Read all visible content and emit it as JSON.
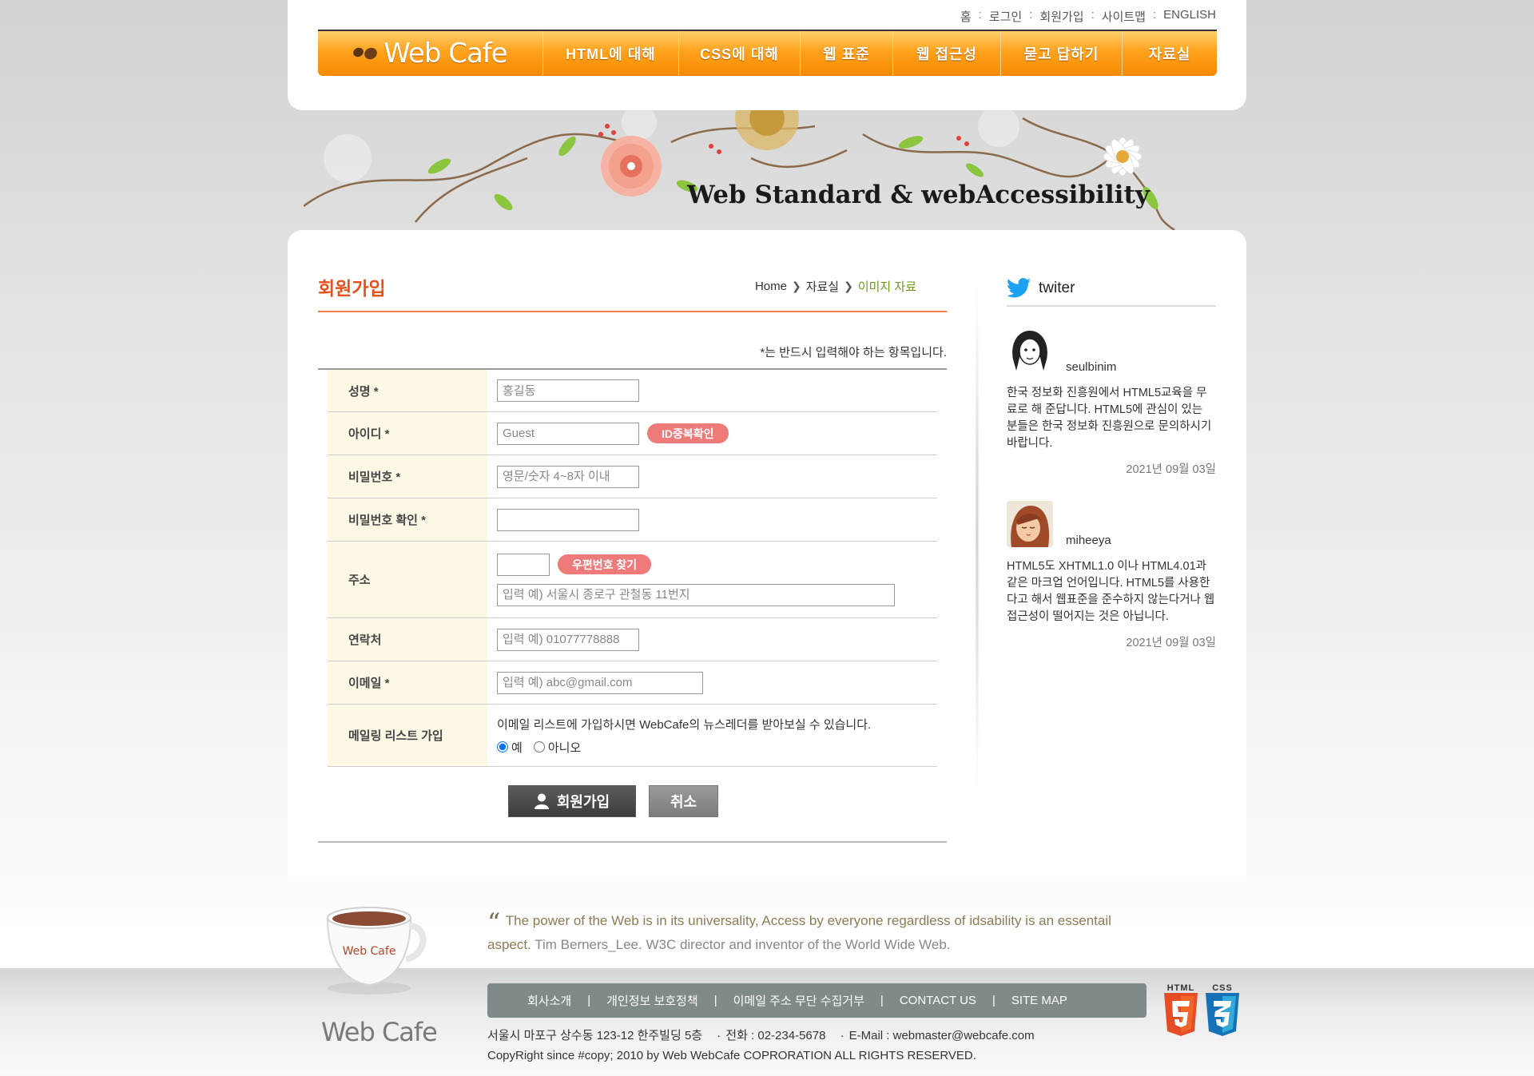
{
  "util": {
    "items": [
      "홈",
      "로그인",
      "회원가입",
      "사이트맵",
      "ENGLISH"
    ],
    "separator": ":"
  },
  "logo": {
    "text": "Web Cafe"
  },
  "gnb": {
    "items": [
      "HTML에 대해",
      "CSS에 대해",
      "웹 표준",
      "웹 접근성",
      "묻고 답하기",
      "자료실"
    ]
  },
  "visual": {
    "title": "Web Standard & webAccessibility"
  },
  "page": {
    "title": "회원가입",
    "breadcrumb": [
      "Home",
      "자료실",
      "이미지 자료"
    ],
    "required_note": "*는 반드시 입력해야 하는 항목입니다."
  },
  "form": {
    "name": {
      "label": "성명 *",
      "placeholder": "홍길동"
    },
    "id": {
      "label": "아이디 *",
      "placeholder": "Guest",
      "check_button": "ID중복확인"
    },
    "password": {
      "label": "비밀번호 *",
      "placeholder": "영문/숫자 4~8자 이내"
    },
    "password_confirm": {
      "label": "비밀번호 확인 *",
      "placeholder": ""
    },
    "address": {
      "label": "주소",
      "zip_placeholder": "",
      "zip_button": "우편번호 찾기",
      "detail_placeholder": "입력 예) 서울시 종로구 관철동 11번지"
    },
    "phone": {
      "label": "연락처",
      "placeholder": "입력 예) 01077778888"
    },
    "email": {
      "label": "이메일 *",
      "placeholder": "입력 예) abc@gmail.com"
    },
    "mailing": {
      "label": "메일링 리스트 가입",
      "description": "이메일 리스트에 가입하시면 WebCafe의 뉴스레더를 받아보실 수 있습니다.",
      "options": [
        "예",
        "아니오"
      ],
      "selected": "예"
    },
    "submit_label": "회원가입",
    "cancel_label": "취소"
  },
  "twitter": {
    "title": "twiter",
    "tweets": [
      {
        "user": "seulbinim",
        "message": "한국 정보화 진흥원에서 HTML5교육을 무료로 해 준답니다. HTML5에 관심이 있는 분들은 한국 정보화 진흥원으로 문의하시기 바랍니다.",
        "date": "2021년 09월 03일"
      },
      {
        "user": "miheeya",
        "message": "HTML5도 XHTML1.0 이나 HTML4.01과 같은 마크업 언어입니다. HTML5를 사용한다고 해서 웹표준을 준수하지 않는다거나 웹접근성이 떨어지는 것은 아닙니다.",
        "date": "2021년 09월 03일"
      }
    ]
  },
  "footer": {
    "cup_label": "Web Cafe",
    "logo": "Web Cafe",
    "quote": "The power of the Web is in its universality, Access by everyone regardless of idsability is an essentail aspect.",
    "quote_author": "Tim Berners_Lee. W3C director and inventor of the World Wide Web.",
    "links": [
      "회사소개",
      "개인정보 보호정책",
      "이메일 주소 무단 수집거부",
      "CONTACT US",
      "SITE MAP"
    ],
    "address": "서울시 마포구 상수동 123-12 한주빌딩 5층",
    "phone": "전화 : 02-234-5678",
    "email": "E-Mail : webmaster@webcafe.com",
    "copyright": "CopyRight since #copy; 2010 by Web WebCafe COPRORATION ALL RIGHTS RESERVED.",
    "badges": [
      "HTML",
      "CSS"
    ]
  },
  "colors": {
    "accent_orange": "#f68a00",
    "title_red": "#e8501b",
    "breadcrumb_green": "#6a9a1f",
    "pill_pink": "#ef7a7a",
    "twitter_blue": "#1da1f2"
  }
}
